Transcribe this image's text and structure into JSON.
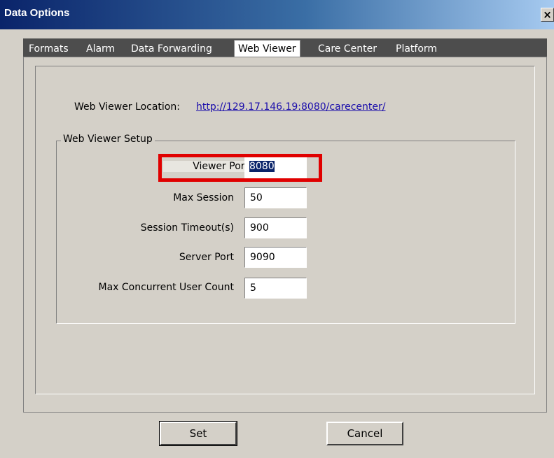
{
  "window": {
    "title": "Data Options",
    "close_glyph": "×"
  },
  "tabs": [
    {
      "label": "Formats"
    },
    {
      "label": "Alarm"
    },
    {
      "label": "Data Forwarding"
    },
    {
      "label": "Web Viewer",
      "active": true
    },
    {
      "label": "Care Center"
    },
    {
      "label": "Platform"
    }
  ],
  "web_viewer": {
    "location_label": "Web Viewer Location:",
    "location_url": "http://129.17.146.19:8080/carecenter/",
    "setup_group": "Web Viewer Setup",
    "fields": [
      {
        "label": "Viewer Port",
        "value": "8080"
      },
      {
        "label": "Max Session",
        "value": "50"
      },
      {
        "label": "Session Timeout(s)",
        "value": "900"
      },
      {
        "label": "Server Port",
        "value": "9090"
      },
      {
        "label": "Max Concurrent User Count",
        "value": "5"
      }
    ]
  },
  "buttons": {
    "set": "Set",
    "cancel": "Cancel"
  },
  "colors": {
    "highlight": "#e00000",
    "titlebar": "#0a246a",
    "link": "#1a0dab"
  }
}
